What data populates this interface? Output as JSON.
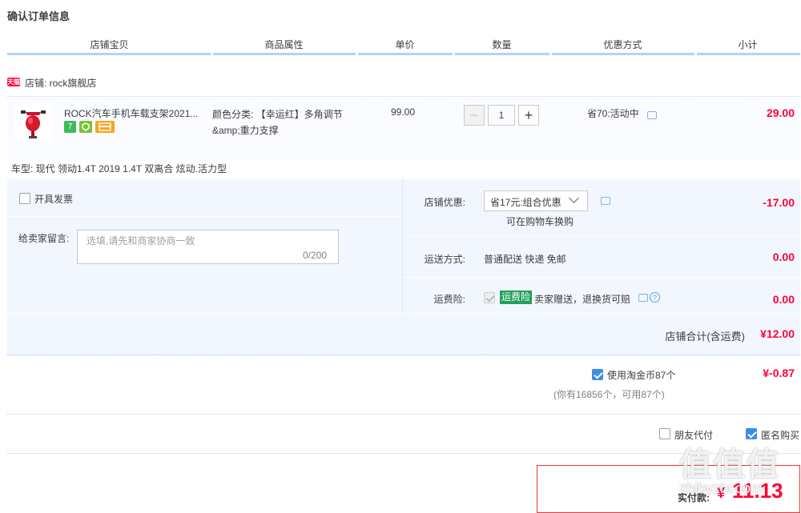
{
  "page": {
    "title": "确认订单信息"
  },
  "columns": [
    "店铺宝贝",
    "商品属性",
    "单价",
    "数量",
    "优惠方式",
    "小计"
  ],
  "shop": {
    "badge": "天猫",
    "name": "店铺: rock旗舰店"
  },
  "item": {
    "title": "ROCK汽车手机车载支架2021...",
    "badges": [
      "7",
      "",
      ""
    ],
    "attr": "颜色分类: 【幸运红】多角调节&amp;重力支撑",
    "price": "99.00",
    "quantity": "1",
    "minus": "−",
    "plus": "+",
    "discount": "省70:活动中",
    "subtotal": "29.00",
    "car_type": "车型: 现代 领动1.4T 2019 1.4T 双离合 炫动.活力型"
  },
  "invoice": {
    "label": "开具发票"
  },
  "message": {
    "label": "给卖家留言:",
    "placeholder": "选填,请先和商家协商一致",
    "count": "0/200"
  },
  "shop_discount": {
    "label": "店铺优惠:",
    "selected": "省17元:组合优惠",
    "hint": "可在购物车换购",
    "amount": "-17.00"
  },
  "shipping": {
    "label": "运送方式:",
    "value": "普通配送 快递 免邮",
    "amount": "0.00"
  },
  "insurance": {
    "label": "运费险:",
    "badge": "运费险",
    "text": "卖家赠送，退换货可赔",
    "amount": "0.00",
    "help": "?"
  },
  "shop_total": {
    "label": "店铺合计(含运费)",
    "amount": "¥12.00"
  },
  "coins": {
    "label": "使用淘金币87个",
    "amount": "¥-0.87",
    "hint": "(你有16856个，可用87个)"
  },
  "options": {
    "friend_pay": "朋友代付",
    "anonymous": "匿名购买"
  },
  "pay": {
    "label": "实付款:",
    "currency": "¥",
    "amount": "11.13"
  },
  "watermark": {
    "logo": "值值值",
    "url": "zhibyzhi.com"
  }
}
